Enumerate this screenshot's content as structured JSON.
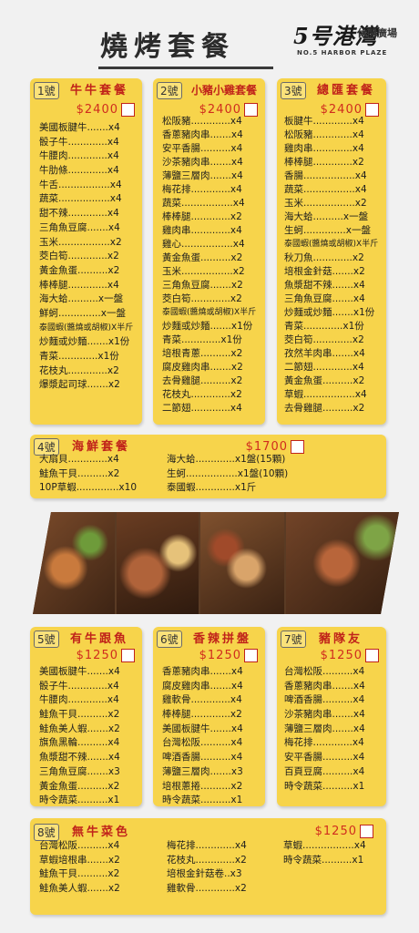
{
  "header": {
    "title": "燒烤套餐",
    "brand_main": "5号港灣",
    "brand_sub": "休閒廣場",
    "brand_en": "NO.5 HARBOR PLAZE"
  },
  "colors": {
    "card": "#f7d44b",
    "accent_red": "#c0231a",
    "price_red": "#d02d1e"
  },
  "photo_strip": {
    "description_icon": "bbq-food-photo"
  },
  "sets": [
    {
      "num": "1號",
      "name": "牛牛套餐",
      "price": "$2400",
      "items": [
        "美國板腱牛.......x4",
        "骰子牛.............x4",
        "牛腰肉.............x4",
        "牛肋條.............x4",
        "牛舌.................x4",
        "蔬菜.................x4",
        "甜不辣.............x4",
        "三角魚豆腐.......x4",
        "玉米.................x2",
        "茭白筍.............x2",
        "黃金魚蛋..........x2",
        "棒棒腿.............x4",
        "海大蛤..........x一盤",
        "鮮蚵..............x一盤",
        "泰國蝦(醬燒或胡椒)X半斤",
        "炒麵或炒麵.......x1份",
        "青菜.............x1份",
        "花枝丸.............x2",
        "爆漿起司球.......x2"
      ]
    },
    {
      "num": "2號",
      "name": "小豬小雞套餐",
      "price": "$2400",
      "items": [
        "松阪豬.............x4",
        "香蔥豬肉串.......x4",
        "安平香腸..........x4",
        "沙茶豬肉串.......x4",
        "薄鹽三層肉.......x4",
        "梅花排.............x4",
        "蔬菜.................x4",
        "棒棒腿.............x2",
        "雞肉串.............x4",
        "雞心.................x4",
        "黃金魚蛋..........x2",
        "玉米.................x2",
        "三角魚豆腐.......x2",
        "茭白筍.............x2",
        "泰國蝦(醬燒或胡椒)X半斤",
        "炒麵或炒麵.......x1份",
        "青菜.............x1份",
        "培根青蔥..........x2",
        "腐皮雞肉串.......x2",
        "去骨雞腿..........x2",
        "花枝丸.............x2",
        "二節翅.............x4"
      ]
    },
    {
      "num": "3號",
      "name": "總匯套餐",
      "price": "$2400",
      "items": [
        "板腱牛.............x4",
        "松阪豬.............x4",
        "雞肉串.............x4",
        "棒棒腿.............x2",
        "香腸.................x4",
        "蔬菜.................x4",
        "玉米.................x2",
        "海大蛤..........x一盤",
        "生蚵..............x一盤",
        "泰國蝦(醬燒或胡椒)X半斤",
        "秋刀魚.............x2",
        "培根金針菇.......x2",
        "魚漿甜不辣.......x4",
        "三角魚豆腐.......x4",
        "炒麵或炒麵.......x1份",
        "青菜.............x1份",
        "茭白筍.............x2",
        "孜然羊肉串.......x4",
        "二節翅.............x4",
        "黃金魚蛋..........x2",
        "草蝦.................x4",
        "去骨雞腿..........x2"
      ]
    },
    {
      "num": "4號",
      "name": "海鮮套餐",
      "price": "$1700",
      "col1": [
        "大扇貝.............x4",
        "鮭魚干貝..........x2",
        "10P草蝦..............x10"
      ],
      "col2": [
        "海大蛤.............x1盤(15顆)",
        "生蚵.................x1盤(10顆)",
        "泰國蝦.............x1斤"
      ]
    },
    {
      "num": "5號",
      "name": "有牛跟魚",
      "price": "$1250",
      "items": [
        "美國板腱牛.......x4",
        "骰子牛.............x4",
        "牛腰肉.............x4",
        "鮭魚干貝..........x2",
        "鮭魚美人蝦.......x2",
        "旗魚黑輪..........x4",
        "魚漿甜不辣.......x4",
        "三角魚豆腐.......x3",
        "黃金魚蛋..........x2",
        "時令蔬菜..........x1"
      ]
    },
    {
      "num": "6號",
      "name": "香辣拼盤",
      "price": "$1250",
      "items": [
        "香蔥豬肉串.......x4",
        "腐皮雞肉串.......x4",
        "雞軟骨.............x4",
        "棒棒腿.............x2",
        "美國板腱牛.......x4",
        "台灣松阪..........x4",
        "啤酒香腸..........x4",
        "薄鹽三層肉.......x3",
        "培根蔥捲..........x2",
        "時令蔬菜..........x1"
      ]
    },
    {
      "num": "7號",
      "name": "豬隊友",
      "price": "$1250",
      "items": [
        "台灣松阪..........x4",
        "香蔥豬肉串.......x4",
        "啤酒香腸..........x4",
        "沙茶豬肉串.......x4",
        "薄鹽三層肉.......x4",
        "梅花排.............x4",
        "安平香腸..........x4",
        "百頁豆腐..........x4",
        "時令蔬菜..........x1"
      ]
    },
    {
      "num": "8號",
      "name": "無牛菜色",
      "price": "$1250",
      "col1": [
        "台灣松阪..........x4",
        "草蝦培根串.......x2",
        "鮭魚干貝..........x2",
        "鮭魚美人蝦.......x2"
      ],
      "col2": [
        "梅花排.............x4",
        "花枝丸.............x2",
        "培根金針菇卷..x3",
        "雞軟骨.............x2"
      ],
      "col3": [
        "草蝦.................x4",
        "時令蔬菜..........x1"
      ]
    }
  ]
}
